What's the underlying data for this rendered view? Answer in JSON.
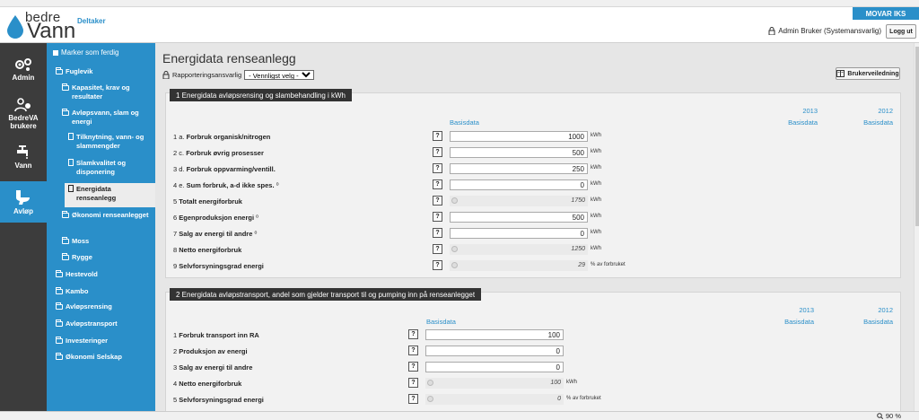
{
  "header": {
    "brand_top": "bedre",
    "brand_bottom": "Vann",
    "deltaker": "Deltaker",
    "org_name": "MOVAR IKS",
    "user_label": "Admin Bruker (Systemansvarlig)",
    "logout_label": "Logg ut"
  },
  "leftnav": [
    {
      "label": "Admin",
      "icon": "gears-icon"
    },
    {
      "label": "BedreVA brukere",
      "icon": "users-icon"
    },
    {
      "label": "Vann",
      "icon": "tap-icon"
    },
    {
      "label": "Avløp",
      "icon": "toilet-icon"
    }
  ],
  "tree": {
    "mark_done": "Marker som ferdig",
    "items": [
      {
        "label": "Fuglevik"
      },
      {
        "label": "Kapasitet, krav og resultater"
      },
      {
        "label": "Avløpsvann, slam og energi"
      },
      {
        "label": "Tilknytning, vann- og slammengder"
      },
      {
        "label": "Slamkvalitet og disponering"
      },
      {
        "label": "Energidata renseanlegg"
      },
      {
        "label": "Økonomi renseanlegget"
      },
      {
        "label": "Moss"
      },
      {
        "label": "Rygge"
      },
      {
        "label": "Hestevold"
      },
      {
        "label": "Kambo"
      },
      {
        "label": "Avløpsrensing"
      },
      {
        "label": "Avløpstransport"
      },
      {
        "label": "Investeringer"
      },
      {
        "label": "Økonomi Selskap"
      }
    ]
  },
  "main": {
    "title": "Energidata renseanlegg",
    "resp_label": "Rapporteringsansvarlig",
    "resp_value": "- Vennligst velg -",
    "guide_label": "Brukerveiledning",
    "help_label": "?"
  },
  "section1": {
    "title": "1  Energidata avløpsrensing og slambehandling i kWh",
    "col_head": "Basisdata",
    "years": [
      "2013",
      "2012"
    ],
    "year_sub": "Basisdata",
    "rows": [
      {
        "num": "1 a.",
        "label": "Forbruk organisk/nitrogen",
        "value": "1000",
        "unit": "kWh",
        "calc": false
      },
      {
        "num": "2 c.",
        "label": "Forbruk øvrig prosesser",
        "value": "500",
        "unit": "kWh",
        "calc": false
      },
      {
        "num": "3 d.",
        "label": "Forbruk oppvarming/ventill.",
        "value": "250",
        "unit": "kWh",
        "calc": false
      },
      {
        "num": "4 e.",
        "label": "Sum forbruk, a-d ikke spes.",
        "value": "0",
        "unit": "kWh",
        "calc": false,
        "sup": "⁰"
      },
      {
        "num": "5",
        "label": "Totalt energiforbruk",
        "value": "1750",
        "unit": "kWh",
        "calc": true
      },
      {
        "num": "6",
        "label": "Egenproduksjon energi",
        "value": "500",
        "unit": "kWh",
        "calc": false,
        "sup": "⁰"
      },
      {
        "num": "7",
        "label": "Salg av energi til andre",
        "value": "0",
        "unit": "kWh",
        "calc": false,
        "sup": "⁰"
      },
      {
        "num": "8",
        "label": "Netto energiforbruk",
        "value": "1250",
        "unit": "kWh",
        "calc": true
      },
      {
        "num": "9",
        "label": "Selvforsyningsgrad energi",
        "value": "29",
        "unit": "% av forbruket",
        "calc": true
      }
    ]
  },
  "section2": {
    "title": "2  Energidata avløpstransport, andel som gjelder transport til og pumping inn på renseanlegget",
    "col_head": "Basisdata",
    "years": [
      "2013",
      "2012"
    ],
    "year_sub": "Basisdata",
    "rows": [
      {
        "num": "1",
        "label": "Forbruk transport inn RA",
        "value": "100",
        "unit": "",
        "calc": false
      },
      {
        "num": "2",
        "label": "Produksjon av energi",
        "value": "0",
        "unit": "",
        "calc": false
      },
      {
        "num": "3",
        "label": "Salg av energi til andre",
        "value": "0",
        "unit": "",
        "calc": false
      },
      {
        "num": "4",
        "label": "Netto energiforbruk",
        "value": "100",
        "unit": "kWh",
        "calc": true
      },
      {
        "num": "5",
        "label": "Selvforsyningsgrad energi",
        "value": "0",
        "unit": "% av forbruket",
        "calc": true
      }
    ]
  },
  "status": {
    "zoom": "90 %"
  },
  "colors": {
    "accent": "#2a8fc9",
    "dark_nav": "#3c3c3c",
    "section_header": "#333333"
  }
}
